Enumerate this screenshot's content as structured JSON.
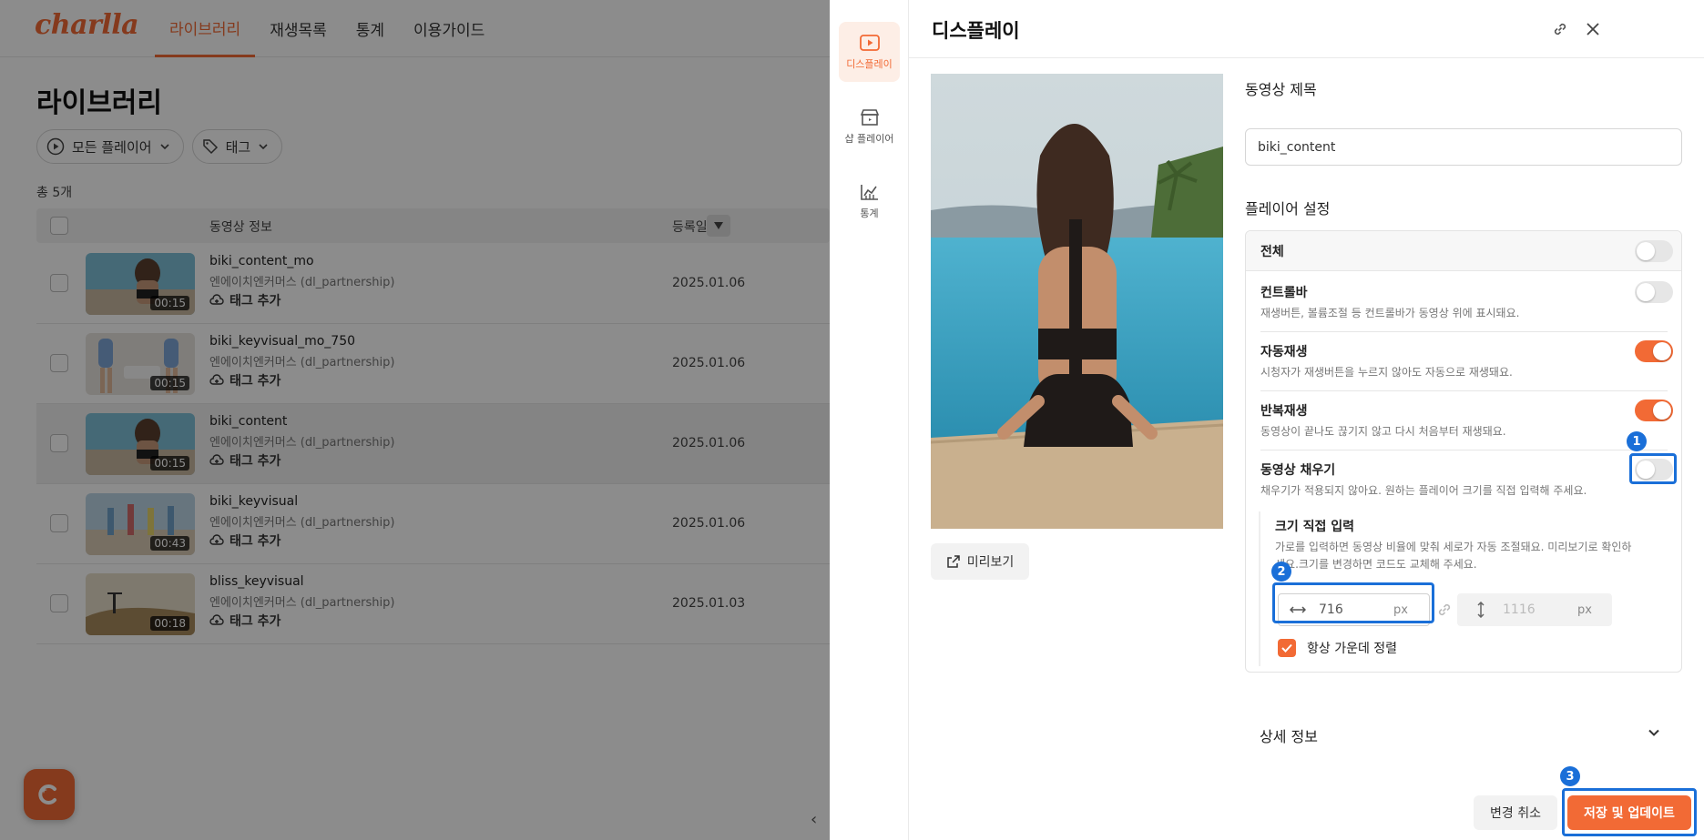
{
  "app": {
    "logo": "charlla",
    "nav": [
      "라이브러리",
      "재생목록",
      "통계",
      "이용가이드"
    ],
    "active_nav": "라이브러리"
  },
  "library": {
    "title": "라이브러리",
    "filter_player": "모든 플레이어",
    "filter_tag": "태그",
    "total": "총 5개",
    "col_info": "동영상 정보",
    "col_date": "등록일",
    "tag_add": "태그 추가",
    "videos": [
      {
        "title": "biki_content_mo",
        "owner": "엔에이치엔커머스 (dl_partnership)",
        "duration": "00:15",
        "date": "2025.01.06",
        "thumb": "pool-back"
      },
      {
        "title": "biki_keyvisual_mo_750",
        "owner": "엔에이치엔커머스 (dl_partnership)",
        "duration": "00:15",
        "date": "2025.01.06",
        "thumb": "blue-swimsuit"
      },
      {
        "title": "biki_content",
        "owner": "엔에이치엔커머스 (dl_partnership)",
        "duration": "00:15",
        "date": "2025.01.06",
        "thumb": "pool-back",
        "selected": true
      },
      {
        "title": "biki_keyvisual",
        "owner": "엔에이치엔커머스 (dl_partnership)",
        "duration": "00:43",
        "date": "2025.01.06",
        "thumb": "beach-group"
      },
      {
        "title": "bliss_keyvisual",
        "owner": "엔에이치엔커머스 (dl_partnership)",
        "duration": "00:18",
        "date": "2025.01.03",
        "thumb": "sand-desert"
      }
    ]
  },
  "panel": {
    "tabs": [
      {
        "label": "디스플레이",
        "icon": "play-square-icon",
        "active": true
      },
      {
        "label": "샵 플레이어",
        "icon": "shop-icon",
        "active": false
      },
      {
        "label": "통계",
        "icon": "chart-icon",
        "active": false
      }
    ],
    "title": "디스플레이",
    "preview_button": "미리보기",
    "video_title_label": "동영상 제목",
    "video_title_value": "biki_content",
    "player_settings_label": "플레이어 설정",
    "settings": {
      "all": {
        "label": "전체",
        "on": false
      },
      "controlbar": {
        "label": "컨트롤바",
        "desc": "재생버튼, 볼륨조절 등 컨트롤바가 동영상 위에 표시돼요.",
        "on": false
      },
      "autoplay": {
        "label": "자동재생",
        "desc": "시청자가 재생버튼을 누르지 않아도 자동으로 재생돼요.",
        "on": true
      },
      "loop": {
        "label": "반복재생",
        "desc": "동영상이 끝나도 끊기지 않고 다시 처음부터 재생돼요.",
        "on": true
      },
      "fill": {
        "label": "동영상 채우기",
        "desc": "채우기가 적용되지 않아요. 원하는 플레이어 크기를 직접 입력해 주세요.",
        "on": false
      }
    },
    "size": {
      "title": "크기 직접 입력",
      "desc": "가로를 입력하면 동영상 비율에 맞춰 세로가 자동 조절돼요. 미리보기로 확인하세요.크기를 변경하면 코드도 교체해 주세요.",
      "width": "716",
      "height": "1116",
      "unit": "px",
      "center_label": "항상 가운데 정렬",
      "center_checked": true
    },
    "detail_label": "상세 정보",
    "cancel_button": "변경 취소",
    "save_button": "저장 및 업데이트"
  },
  "annotations": [
    "1",
    "2",
    "3"
  ],
  "colors": {
    "accent": "#f26a35",
    "annotation": "#1a6fd8"
  }
}
